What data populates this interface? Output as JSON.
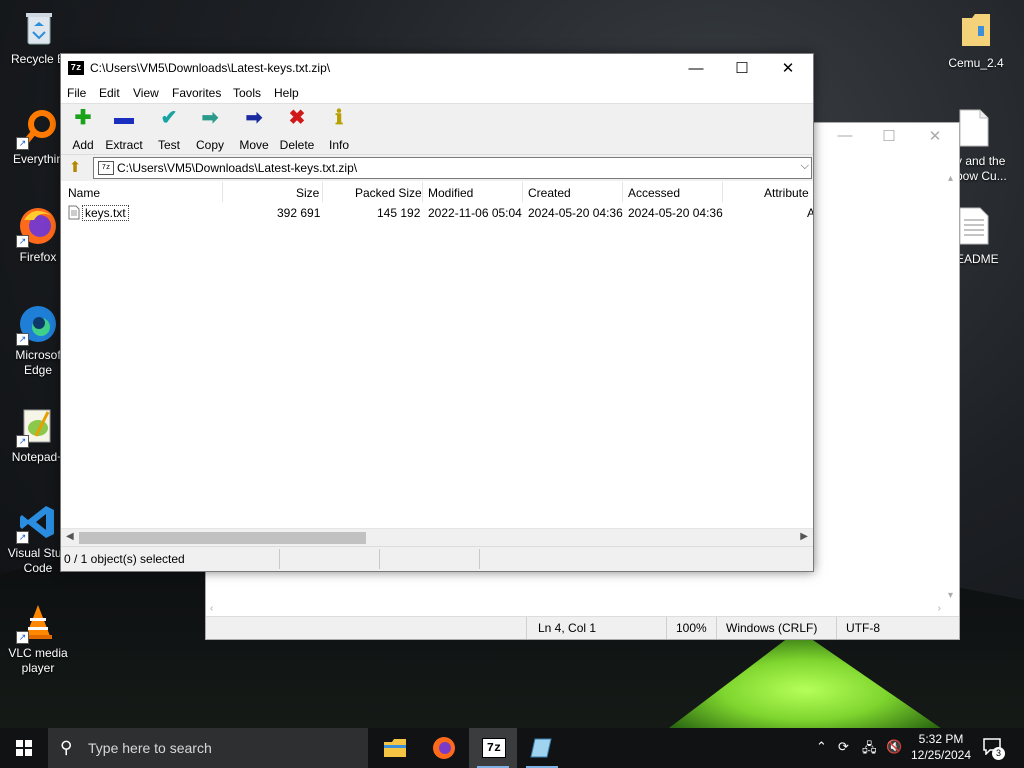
{
  "desktop": {
    "icons": [
      {
        "label": "Recycle B",
        "icon": "recycle-bin-icon"
      },
      {
        "label": "Everythin",
        "icon": "search-everything-icon"
      },
      {
        "label": "Firefox",
        "icon": "firefox-icon"
      },
      {
        "label": "Microsof Edge",
        "icon": "edge-icon"
      },
      {
        "label": "Notepad+",
        "icon": "notepad-plus-icon"
      },
      {
        "label": "Visual Stud Code",
        "icon": "vscode-icon"
      },
      {
        "label": "VLC media player",
        "icon": "vlc-icon"
      }
    ],
    "right_icons": [
      {
        "label": "Cemu_2.4",
        "icon": "folder-icon"
      },
      {
        "label": "y and the",
        "label2": "bow Cu...",
        "icon": "document-icon"
      },
      {
        "label": "EADME",
        "icon": "text-document-icon"
      }
    ]
  },
  "notepad_window": {
    "status": {
      "position": "Ln 4, Col 1",
      "zoom": "100%",
      "line_ending": "Windows (CRLF)",
      "encoding": "UTF-8"
    }
  },
  "zip_window": {
    "title": "C:\\Users\\VM5\\Downloads\\Latest-keys.txt.zip\\",
    "app_icon_text": "7z",
    "menu": [
      "File",
      "Edit",
      "View",
      "Favorites",
      "Tools",
      "Help"
    ],
    "toolbar": [
      {
        "label": "Add",
        "icon": "plus-icon",
        "glyph": "✚",
        "color": "#1aa31a"
      },
      {
        "label": "Extract",
        "icon": "minus-icon",
        "glyph": "▬",
        "color": "#1a2fbf"
      },
      {
        "label": "Test",
        "icon": "check-icon",
        "glyph": "✔",
        "color": "#1aa3a3"
      },
      {
        "label": "Copy",
        "icon": "copy-arrow-icon",
        "glyph": "➡",
        "color": "#2a9a8a"
      },
      {
        "label": "Move",
        "icon": "move-arrow-icon",
        "glyph": "➡",
        "color": "#1a2a9f"
      },
      {
        "label": "Delete",
        "icon": "delete-x-icon",
        "glyph": "✖",
        "color": "#d01818"
      },
      {
        "label": "Info",
        "icon": "info-icon",
        "glyph": "ℹ",
        "color": "#b8a000"
      }
    ],
    "address": "C:\\Users\\VM5\\Downloads\\Latest-keys.txt.zip\\",
    "columns": [
      "Name",
      "Size",
      "Packed Size",
      "Modified",
      "Created",
      "Accessed",
      "Attribute"
    ],
    "rows": [
      {
        "name": "keys.txt",
        "size": "392 691",
        "packed": "145 192",
        "modified": "2022-11-06 05:04",
        "created": "2024-05-20 04:36",
        "accessed": "2024-05-20 04:36",
        "attr": "A"
      }
    ],
    "status": "0 / 1 object(s) selected"
  },
  "taskbar": {
    "search_placeholder": "Type here to search",
    "time": "5:32 PM",
    "date": "12/25/2024",
    "notification_count": "3",
    "apps": [
      "file-explorer-icon",
      "firefox-icon",
      "7zip-icon",
      "notepad-icon"
    ]
  }
}
